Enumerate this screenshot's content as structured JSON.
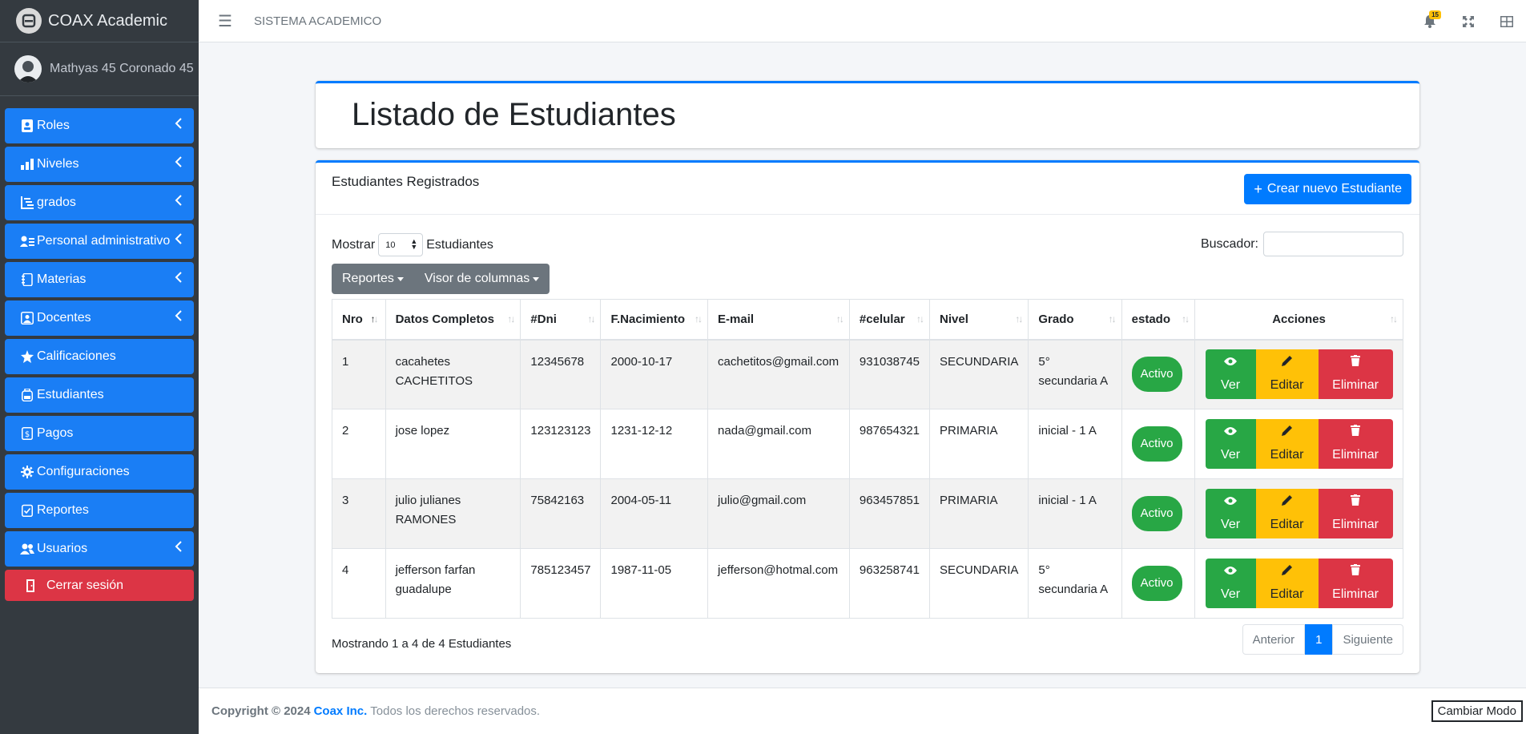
{
  "brand": {
    "name": "COAX Academic"
  },
  "user": {
    "name": "Mathyas 45 Coronado 45"
  },
  "sidebar": {
    "items": [
      {
        "label": "Roles"
      },
      {
        "label": "Niveles"
      },
      {
        "label": "grados"
      },
      {
        "label": "Personal administrativo"
      },
      {
        "label": "Materias"
      },
      {
        "label": "Docentes"
      },
      {
        "label": "Calificaciones"
      },
      {
        "label": "Estudiantes"
      },
      {
        "label": "Pagos"
      },
      {
        "label": "Configuraciones"
      },
      {
        "label": "Reportes"
      },
      {
        "label": "Usuarios"
      }
    ],
    "logout": "Cerrar sesión"
  },
  "topbar": {
    "title": "SISTEMA ACADEMICO",
    "notifications": "15"
  },
  "page": {
    "title": "Listado de Estudiantes"
  },
  "card": {
    "title": "Estudiantes Registrados",
    "create_button": "Crear nuevo Estudiante",
    "show_label": "Mostrar",
    "show_value": "10",
    "show_suffix": "Estudiantes",
    "search_label": "Buscador:",
    "search_value": "",
    "reports_button": "Reportes",
    "columns_button": "Visor de columnas"
  },
  "table": {
    "headers": [
      "Nro",
      "Datos Completos",
      "#Dni",
      "F.Nacimiento",
      "E-mail",
      "#celular",
      "Nivel",
      "Grado",
      "estado",
      "Acciones"
    ],
    "rows": [
      {
        "nro": "1",
        "name": "cacahetes CACHETITOS",
        "dni": "12345678",
        "birth": "2000-10-17",
        "email": "cachetitos@gmail.com",
        "phone": "931038745",
        "level": "SECUNDARIA",
        "grade": "5° secundaria A",
        "status": "Activo"
      },
      {
        "nro": "2",
        "name": "jose lopez",
        "dni": "123123123",
        "birth": "1231-12-12",
        "email": "nada@gmail.com",
        "phone": "987654321",
        "level": "PRIMARIA",
        "grade": "inicial - 1 A",
        "status": "Activo"
      },
      {
        "nro": "3",
        "name": "julio julianes RAMONES",
        "dni": "75842163",
        "birth": "2004-05-11",
        "email": "julio@gmail.com",
        "phone": "963457851",
        "level": "PRIMARIA",
        "grade": "inicial - 1 A",
        "status": "Activo"
      },
      {
        "nro": "4",
        "name": "jefferson farfan guadalupe",
        "dni": "785123457",
        "birth": "1987-11-05",
        "email": "jefferson@hotmal.com",
        "phone": "963258741",
        "level": "SECUNDARIA",
        "grade": "5° secundaria A",
        "status": "Activo"
      }
    ],
    "actions": {
      "view": "Ver",
      "edit": "Editar",
      "delete": "Eliminar"
    }
  },
  "pagination": {
    "info": "Mostrando 1 a 4 de 4 Estudiantes",
    "prev": "Anterior",
    "current": "1",
    "next": "Siguiente"
  },
  "footer": {
    "copyright": "Copyright © 2024",
    "company": "Coax Inc.",
    "rights": "Todos los derechos reservados.",
    "mode_button": "Cambiar Modo"
  },
  "colors": {
    "primary": "#007bff",
    "sidebar": "#343a40",
    "success": "#28a745",
    "warning": "#ffc107",
    "danger": "#dc3545"
  }
}
